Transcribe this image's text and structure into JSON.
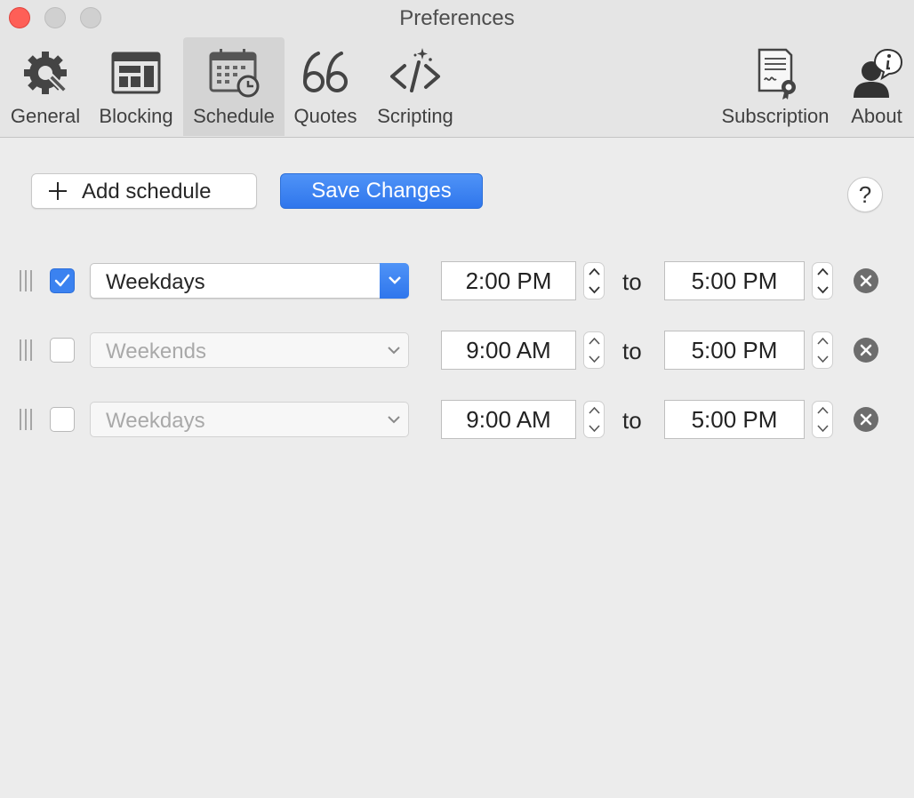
{
  "window": {
    "title": "Preferences"
  },
  "toolbar": {
    "tabs": [
      {
        "label": "General",
        "icon": "gear-wrench-icon"
      },
      {
        "label": "Blocking",
        "icon": "browser-window-icon"
      },
      {
        "label": "Schedule",
        "icon": "calendar-clock-icon",
        "selected": true
      },
      {
        "label": "Quotes",
        "icon": "quote-marks-icon"
      },
      {
        "label": "Scripting",
        "icon": "code-sparkle-icon"
      },
      {
        "label": "Subscription",
        "icon": "certificate-icon"
      },
      {
        "label": "About",
        "icon": "person-info-icon"
      }
    ]
  },
  "actions": {
    "add_label": "Add schedule",
    "save_label": "Save Changes",
    "help_label": "?"
  },
  "schedules": [
    {
      "enabled": true,
      "days": "Weekdays",
      "from": "2:00 PM",
      "separator": "to",
      "to": "5:00 PM"
    },
    {
      "enabled": false,
      "days": "Weekends",
      "from": "9:00 AM",
      "separator": "to",
      "to": "5:00 PM"
    },
    {
      "enabled": false,
      "days": "Weekdays",
      "from": "9:00 AM",
      "separator": "to",
      "to": "5:00 PM"
    }
  ],
  "colors": {
    "accent": "#3b82f0",
    "close": "#fe5f57",
    "background": "#ececec"
  }
}
